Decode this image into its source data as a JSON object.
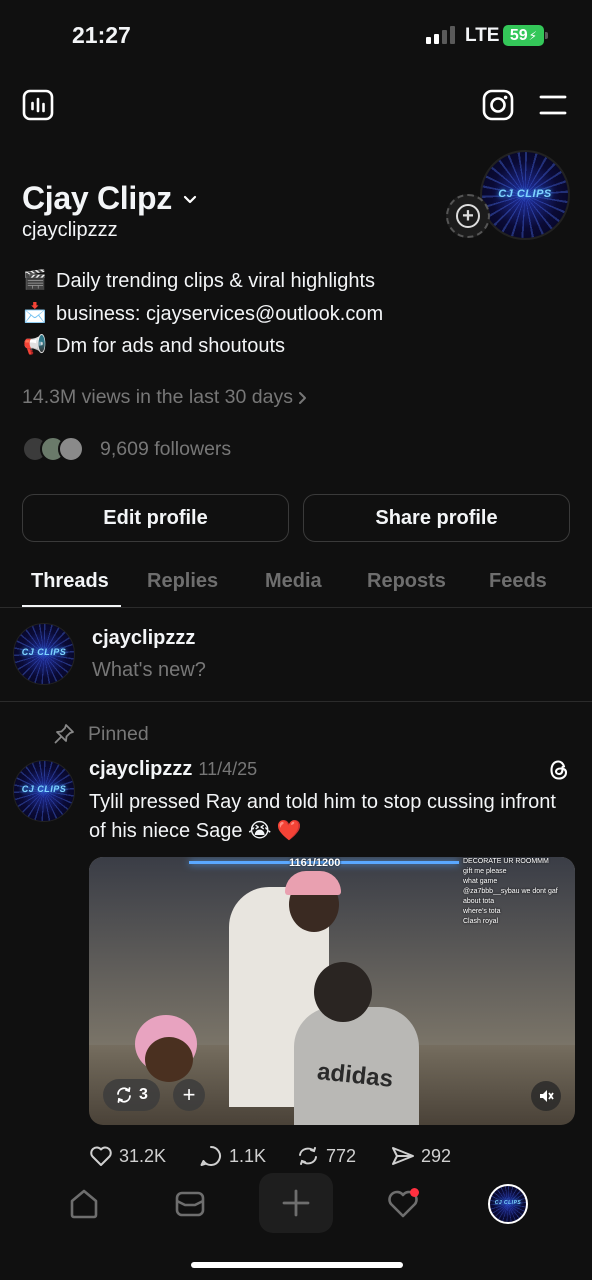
{
  "status": {
    "time": "21:27",
    "network": "LTE",
    "battery": "59"
  },
  "profile": {
    "display_name": "Cjay Clipz",
    "handle": "cjayclipzzz",
    "avatar_text": "CJ CLIPS",
    "bio": [
      {
        "emoji": "🎬",
        "text": "Daily trending clips & viral highlights"
      },
      {
        "emoji": "📩",
        "text": "business: cjayservices@outlook.com"
      },
      {
        "emoji": "📢",
        "text": "Dm for ads and shoutouts"
      }
    ],
    "views": "14.3M views in the last 30 days",
    "followers": "9,609 followers"
  },
  "buttons": {
    "edit": "Edit profile",
    "share": "Share profile"
  },
  "tabs": [
    "Threads",
    "Replies",
    "Media",
    "Reposts",
    "Feeds"
  ],
  "composer": {
    "username": "cjayclipzzz",
    "placeholder": "What's new?"
  },
  "pinned_label": "Pinned",
  "post": {
    "username": "cjayclipzzz",
    "date": "11/4/25",
    "text": "Tylil pressed Ray and told him to stop cussing infront of his niece Sage 😭 ❤️",
    "media": {
      "counter": "1161/1200",
      "shirt_text": "adidas",
      "chat": [
        "DECORATE UR ROOMMM",
        "gift me please",
        "what game",
        "@za7bbb__sybau we dont gaf about tota",
        "where's tota",
        "Clash royal"
      ],
      "repost_count": "3"
    },
    "likes": "31.2K",
    "replies": "1.1K",
    "reposts": "772",
    "shares": "292"
  },
  "colors": {
    "background": "#101010",
    "muted": "#777777",
    "notification": "#ff3040"
  }
}
